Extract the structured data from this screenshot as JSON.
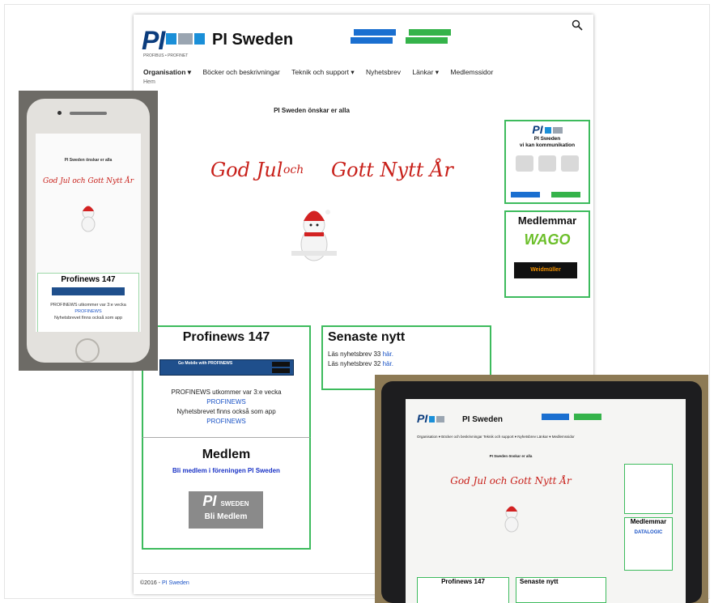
{
  "site": {
    "brand_logo_text": "PI",
    "brand_tagline": "PROFIBUS • PROFINET",
    "title": "PI Sweden",
    "nav": [
      "Organisation",
      "Böcker och beskrivningar",
      "Teknik och support",
      "Nyhetsbrev",
      "Länkar",
      "Medlemssidor"
    ],
    "nav_home": "Hem",
    "greeting": "PI Sweden önskar er alla",
    "script_left": "God Jul",
    "script_mid": "och",
    "script_right": "Gott Nytt År",
    "profinews": {
      "title": "Profinews 147",
      "app_banner": "Go Mobile with PROFINEWS",
      "text1": "PROFINEWS utkommer var 3:e vecka",
      "link1": "PROFINEWS",
      "text2": "Nyhetsbrevet finns också som app",
      "link2": "PROFINEWS"
    },
    "senaste": {
      "title": "Senaste nytt",
      "line1": "Läs nyhetsbrev 33",
      "line1_link": "här.",
      "line2": "Läs nyhetsbrev 32",
      "line2_link": "här."
    },
    "medlem": {
      "title": "Medlem",
      "link": "Bli medlem i föreningen PI Sweden",
      "badge_line1": "PI",
      "badge_line2": "SWEDEN",
      "badge_line3": "Bli Medlem"
    },
    "ad1": {
      "line1": "PI Sweden",
      "line2": "vi kan kommunikation"
    },
    "ad2": {
      "title": "Medlemmar",
      "logo1": "WAGO",
      "logo2": "Weidmüller"
    },
    "footer_year": "©2016 -",
    "footer_link": "PI Sweden"
  },
  "phone": {
    "greeting": "PI Sweden önskar er alla",
    "script": "God Jul och Gott Nytt År",
    "card_title": "Profinews 147",
    "text1": "PROFINEWS utkommer var 3:e vecka",
    "link1": "PROFINEWS",
    "text2": "Nyhetsbrevet finns också som app"
  },
  "tablet": {
    "title": "PI Sweden",
    "nav": "Organisation ▾   Böcker och beskrivningar   Teknik och support ▾   Nyhetsbrev   Länkar ▾   Medlemssidor",
    "greeting": "PI Sweden önskar er alla",
    "script": "God Jul  och  Gott Nytt År",
    "ad_title": "Medlemmar",
    "logo1": "DATALOGIC",
    "card1": "Profinews 147",
    "card2": "Senaste nytt"
  },
  "colors": {
    "green_border": "#3dbb5d",
    "link_blue": "#1a53c6",
    "pi_blue": "#0b3c7d",
    "script_red": "#c8201a"
  }
}
